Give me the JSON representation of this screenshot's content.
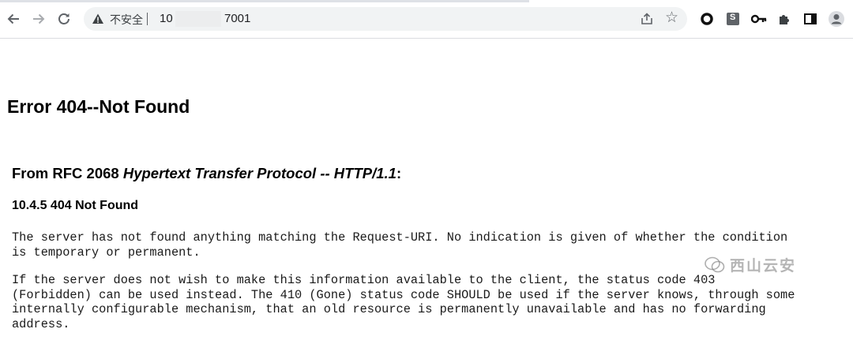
{
  "toolbar": {
    "back_icon": "arrow-left",
    "forward_icon": "arrow-right",
    "reload_icon": "reload",
    "security_label": "不安全",
    "url_visible_start": "10",
    "url_visible_end": "7001",
    "extensions": [
      "circle-icon",
      "s-extension-icon",
      "key-icon",
      "puzzle-icon",
      "side-panel-icon",
      "profile-icon"
    ],
    "extension_s_letter": "S"
  },
  "page": {
    "title": "Error 404--Not Found",
    "rfc_prefix": "From RFC 2068 ",
    "rfc_italic": "Hypertext Transfer Protocol -- HTTP/1.1",
    "rfc_suffix": ":",
    "section": "10.4.5 404 Not Found",
    "paragraph1": "The server has not found anything matching the Request-URI. No indication is given of whether the condition\nis temporary or permanent.",
    "paragraph2": "If the server does not wish to make this information available to the client, the status code 403\n(Forbidden) can be used instead. The 410 (Gone) status code SHOULD be used if the server knows, through some\ninternally configurable mechanism, that an old resource is permanently unavailable and has no forwarding\naddress."
  },
  "watermark": {
    "text": "西山云安"
  },
  "colors": {
    "toolbar_bg": "#ffffff",
    "omnibox_bg": "#f1f3f4",
    "icon": "#5f6368",
    "text": "#000000"
  }
}
